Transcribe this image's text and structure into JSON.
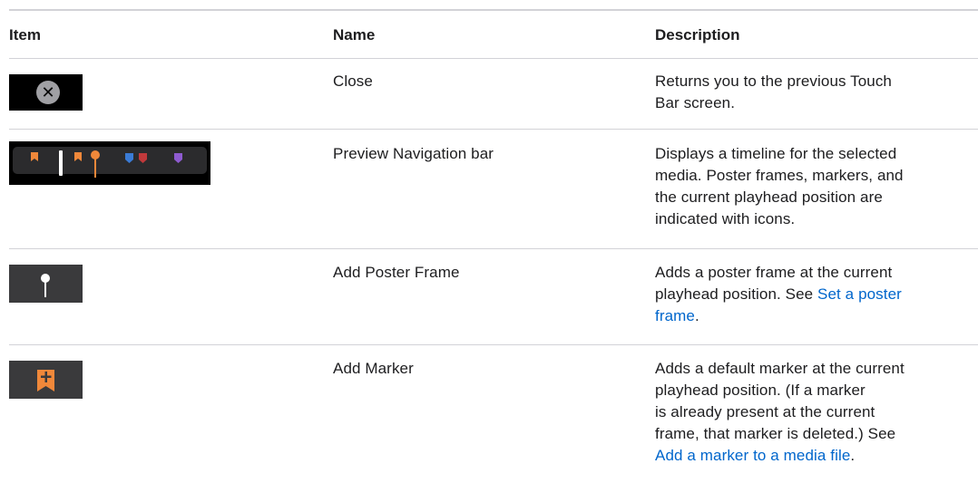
{
  "table": {
    "headers": {
      "item": "Item",
      "name": "Name",
      "description": "Description"
    },
    "rows": [
      {
        "icon": "close-icon",
        "name": "Close",
        "desc_lines": [
          "Returns you to the previous Touch",
          "Bar screen."
        ]
      },
      {
        "icon": "preview-navigation-bar-icon",
        "name": "Preview Navigation bar",
        "desc_lines": [
          "Displays a timeline for the selected",
          "media. Poster frames, markers, and",
          "the current playhead position are",
          "indicated with icons."
        ]
      },
      {
        "icon": "poster-frame-icon",
        "name": "Add Poster Frame",
        "desc_lines": [
          "Adds a poster frame at the current",
          "playhead position. See "
        ],
        "link_part1": "Set a poster",
        "link_part2": "frame",
        "after_link": "."
      },
      {
        "icon": "add-marker-icon",
        "name": "Add Marker",
        "desc_lines": [
          "Adds a default marker at the current",
          "playhead position. (If a marker",
          "is already present at the current",
          "frame, that marker is deleted.) See"
        ],
        "link": "Add a marker to a media file",
        "after_link": "."
      }
    ]
  },
  "colors": {
    "link": "#0066cc",
    "marker_orange": "#f0883a",
    "marker_blue": "#3a7bd5",
    "marker_red": "#c0393b",
    "marker_purple": "#8e5bd0"
  }
}
